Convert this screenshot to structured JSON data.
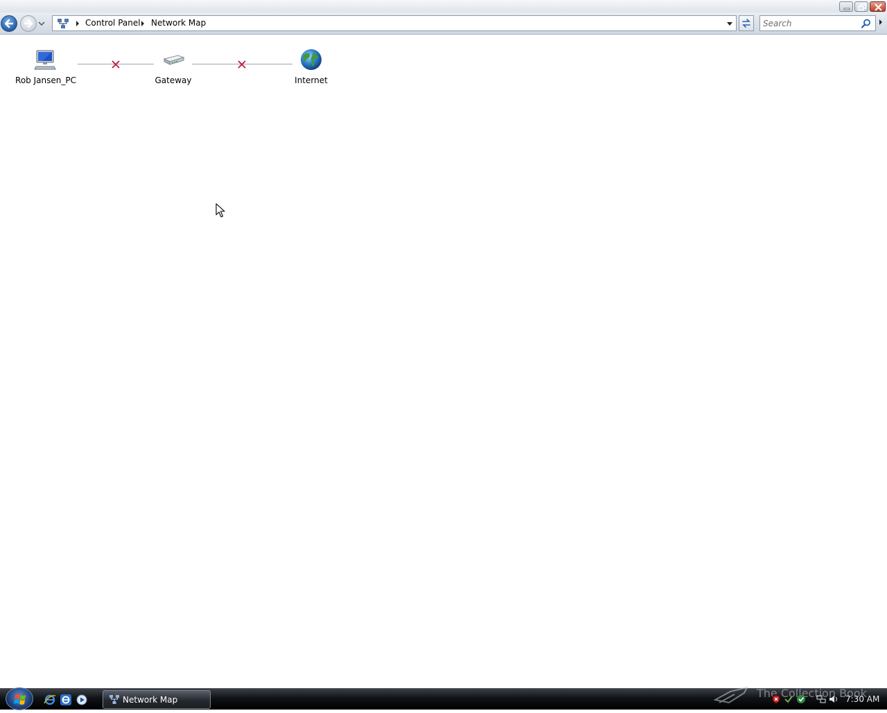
{
  "window": {
    "caption_buttons": [
      "minimize",
      "maximize",
      "close"
    ]
  },
  "address_bar": {
    "root_icon": "network-map-icon",
    "breadcrumbs": [
      {
        "label": "Control Panel"
      },
      {
        "label": "Network Map"
      }
    ]
  },
  "search": {
    "placeholder": "Search"
  },
  "network_map": {
    "nodes": [
      {
        "label": "Rob Jansen_PC",
        "icon": "computer-icon"
      },
      {
        "label": "Gateway",
        "icon": "gateway-router-icon"
      },
      {
        "label": "Internet",
        "icon": "globe-icon"
      }
    ],
    "links": [
      {
        "from": "Rob Jansen_PC",
        "to": "Gateway",
        "status": "broken"
      },
      {
        "from": "Gateway",
        "to": "Internet",
        "status": "broken"
      }
    ],
    "link_color": "#9aa6b3",
    "broken_mark_color": "#c0183a"
  },
  "taskbar": {
    "quick_launch": [
      "internet-explorer-icon",
      "internet-explorer-icon",
      "media-player-icon"
    ],
    "task": {
      "label": "Network Map",
      "icon": "network-map-icon"
    },
    "watermark": "The Collection Book",
    "clock": "7:30 AM"
  }
}
